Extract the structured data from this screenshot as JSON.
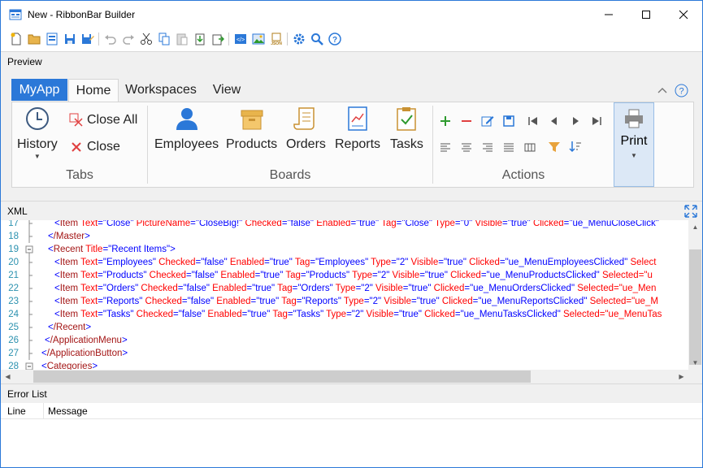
{
  "window": {
    "title": "New - RibbonBar Builder"
  },
  "toolbar_icons": [
    "new-icon",
    "open-icon",
    "open-template-icon",
    "save-icon",
    "save-as-icon",
    "undo-icon",
    "redo-icon",
    "cut-icon",
    "copy-icon",
    "paste-icon",
    "import-icon",
    "export-icon",
    "xml-view-icon",
    "image-icon",
    "json-icon",
    "settings-icon",
    "search-icon",
    "help-icon"
  ],
  "preview": {
    "header": "Preview",
    "app_tab": "MyApp",
    "tabs": [
      "Home",
      "Workspaces",
      "View"
    ],
    "groups": {
      "tabs": {
        "label": "Tabs",
        "history": "History",
        "close_all": "Close All",
        "close": "Close"
      },
      "boards": {
        "label": "Boards",
        "items": [
          "Employees",
          "Products",
          "Orders",
          "Reports",
          "Tasks"
        ]
      },
      "actions": {
        "label": "Actions"
      },
      "print": "Print"
    }
  },
  "xml": {
    "header": "XML",
    "lines": [
      {
        "n": "17",
        "indent": 2,
        "tag": "Item",
        "attrs": [
          [
            "Text",
            "Close"
          ],
          [
            "PictureName",
            "CloseBig!"
          ],
          [
            "Checked",
            "false"
          ],
          [
            "Enabled",
            "true"
          ],
          [
            "Tag",
            "Close"
          ],
          [
            "Type",
            "0"
          ],
          [
            "Visible",
            "true"
          ],
          [
            "Clicked",
            "ue_MenuCloseClick"
          ]
        ],
        "close": ""
      },
      {
        "n": "18",
        "indent": 1,
        "tag": "/Master",
        "attrs": [],
        "close": ">"
      },
      {
        "n": "19",
        "indent": 1,
        "tag": "Recent",
        "attrs": [
          [
            "Title",
            "Recent Items"
          ]
        ],
        "close": ">"
      },
      {
        "n": "20",
        "indent": 2,
        "tag": "Item",
        "attrs": [
          [
            "Text",
            "Employees"
          ],
          [
            "Checked",
            "false"
          ],
          [
            "Enabled",
            "true"
          ],
          [
            "Tag",
            "Employees"
          ],
          [
            "Type",
            "2"
          ],
          [
            "Visible",
            "true"
          ],
          [
            "Clicked",
            "ue_MenuEmployeesClicked"
          ]
        ],
        "tail": "Select"
      },
      {
        "n": "21",
        "indent": 2,
        "tag": "Item",
        "attrs": [
          [
            "Text",
            "Products"
          ],
          [
            "Checked",
            "false"
          ],
          [
            "Enabled",
            "true"
          ],
          [
            "Tag",
            "Products"
          ],
          [
            "Type",
            "2"
          ],
          [
            "Visible",
            "true"
          ],
          [
            "Clicked",
            "ue_MenuProductsClicked"
          ]
        ],
        "tail": "Selected=\"u"
      },
      {
        "n": "22",
        "indent": 2,
        "tag": "Item",
        "attrs": [
          [
            "Text",
            "Orders"
          ],
          [
            "Checked",
            "false"
          ],
          [
            "Enabled",
            "true"
          ],
          [
            "Tag",
            "Orders"
          ],
          [
            "Type",
            "2"
          ],
          [
            "Visible",
            "true"
          ],
          [
            "Clicked",
            "ue_MenuOrdersClicked"
          ]
        ],
        "tail": "Selected=\"ue_Men"
      },
      {
        "n": "23",
        "indent": 2,
        "tag": "Item",
        "attrs": [
          [
            "Text",
            "Reports"
          ],
          [
            "Checked",
            "false"
          ],
          [
            "Enabled",
            "true"
          ],
          [
            "Tag",
            "Reports"
          ],
          [
            "Type",
            "2"
          ],
          [
            "Visible",
            "true"
          ],
          [
            "Clicked",
            "ue_MenuReportsClicked"
          ]
        ],
        "tail": "Selected=\"ue_M"
      },
      {
        "n": "24",
        "indent": 2,
        "tag": "Item",
        "attrs": [
          [
            "Text",
            "Tasks"
          ],
          [
            "Checked",
            "false"
          ],
          [
            "Enabled",
            "true"
          ],
          [
            "Tag",
            "Tasks"
          ],
          [
            "Type",
            "2"
          ],
          [
            "Visible",
            "true"
          ],
          [
            "Clicked",
            "ue_MenuTasksClicked"
          ]
        ],
        "tail": "Selected=\"ue_MenuTas"
      },
      {
        "n": "25",
        "indent": 1,
        "tag": "/Recent",
        "attrs": [],
        "close": ">"
      },
      {
        "n": "26",
        "indent": 0.5,
        "tag": "/ApplicationMenu",
        "attrs": [],
        "close": ">"
      },
      {
        "n": "27",
        "indent": 0,
        "tag": "/ApplicationButton",
        "attrs": [],
        "close": ">"
      },
      {
        "n": "28",
        "indent": 0,
        "tag": "Categories",
        "attrs": [],
        "close": ">"
      }
    ]
  },
  "error_list": {
    "header": "Error List",
    "columns": [
      "Line",
      "Message"
    ]
  },
  "colors": {
    "accent": "#2b78d8",
    "xml_bracket": "#0000ff",
    "xml_element": "#a31515",
    "xml_attr": "#ff0000",
    "line_number": "#2b91af"
  }
}
